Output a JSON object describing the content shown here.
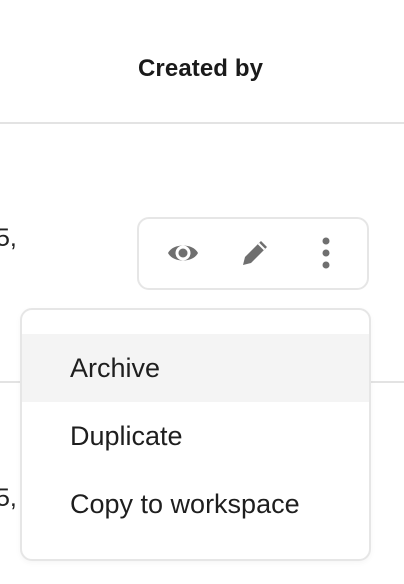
{
  "table": {
    "column_header": "Created by",
    "row1_clipped_text": "5,",
    "row2_clipped_text": "5,"
  },
  "row_actions": {
    "icons": [
      "eye-icon",
      "pencil-icon",
      "more-vertical-icon"
    ],
    "icon_color": "#6f6f6f"
  },
  "context_menu": {
    "items": [
      {
        "label": "Archive",
        "highlighted": true
      },
      {
        "label": "Duplicate",
        "highlighted": false
      },
      {
        "label": "Copy to workspace",
        "highlighted": false
      }
    ]
  }
}
